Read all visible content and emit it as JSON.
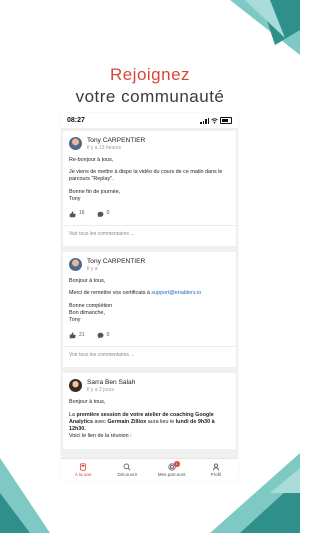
{
  "headline": {
    "line1": "Rejoignez",
    "line2": "votre communauté"
  },
  "colors": {
    "accent": "#d6473a",
    "teal_light": "#7fc9c4",
    "teal_dark": "#2f8f8b",
    "link": "#2266cc"
  },
  "statusbar": {
    "time": "08:27"
  },
  "posts": [
    {
      "author": "Tony CARPENTIER",
      "time": "Il y a 13 heures",
      "body": [
        "Re-bonjour à tous,",
        "Je viens de mettre à dispo la vidéo du cours de ce matin dans le parcours \"Replay\".",
        "Bonne fin de journée,",
        "Tony"
      ],
      "likes": "16",
      "comments": "0",
      "see_comments": "Voir tous les commentaires ..."
    },
    {
      "author": "Tony CARPENTIER",
      "time": "Il y a",
      "body_hello": "Bonjour à tous,",
      "body_pre_link": "Merci de remettre vos certificats à",
      "body_link": "support@enablers.io",
      "body_sign1": "Bonne complétion",
      "body_sign2": "Bon dimanche,",
      "body_sign3": "Tony",
      "likes": "21",
      "comments": "0",
      "see_comments": "Voir tous les commentaires ..."
    },
    {
      "author": "Sarra Ben Salah",
      "time": "Il y a 2 jours",
      "body_hello": "Bonjour à tous,",
      "body_b1": "La ",
      "body_b2": "première session de votre atelier de coaching Google Analytics",
      "body_b3": " avec ",
      "body_b4": "Germain Zilliox",
      "body_b5": " aura lieu le ",
      "body_b6": "lundi de 9h30 à 12h30.",
      "body_b7": "Voici le lien de la réunion :"
    }
  ],
  "tabbar": {
    "items": [
      {
        "label": "À la une",
        "icon": "news-icon"
      },
      {
        "label": "Découvrir",
        "icon": "search-icon"
      },
      {
        "label": "Mes parcours",
        "icon": "target-icon",
        "badge": "1"
      },
      {
        "label": "Profil",
        "icon": "user-icon"
      }
    ]
  }
}
